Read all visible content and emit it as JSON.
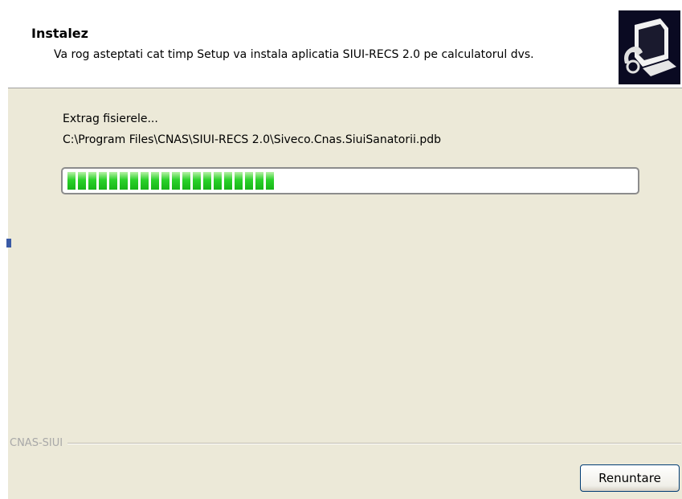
{
  "header": {
    "title": "Instalez",
    "subtitle": "Va rog asteptati cat timp Setup va instala aplicatia SIUI-RECS 2.0 pe calculatorul dvs."
  },
  "status": {
    "line1": "Extrag fisierele...",
    "line2": "C:\\Program Files\\CNAS\\SIUI-RECS 2.0\\Siveco.Cnas.SiuiSanatorii.pdb"
  },
  "progress": {
    "fraction": 0.37,
    "color": "#22c722"
  },
  "group": {
    "label": "CNAS-SIUI"
  },
  "buttons": {
    "cancel_label": "Renuntare"
  },
  "icons": {
    "logo": "setup-computer-icon"
  }
}
